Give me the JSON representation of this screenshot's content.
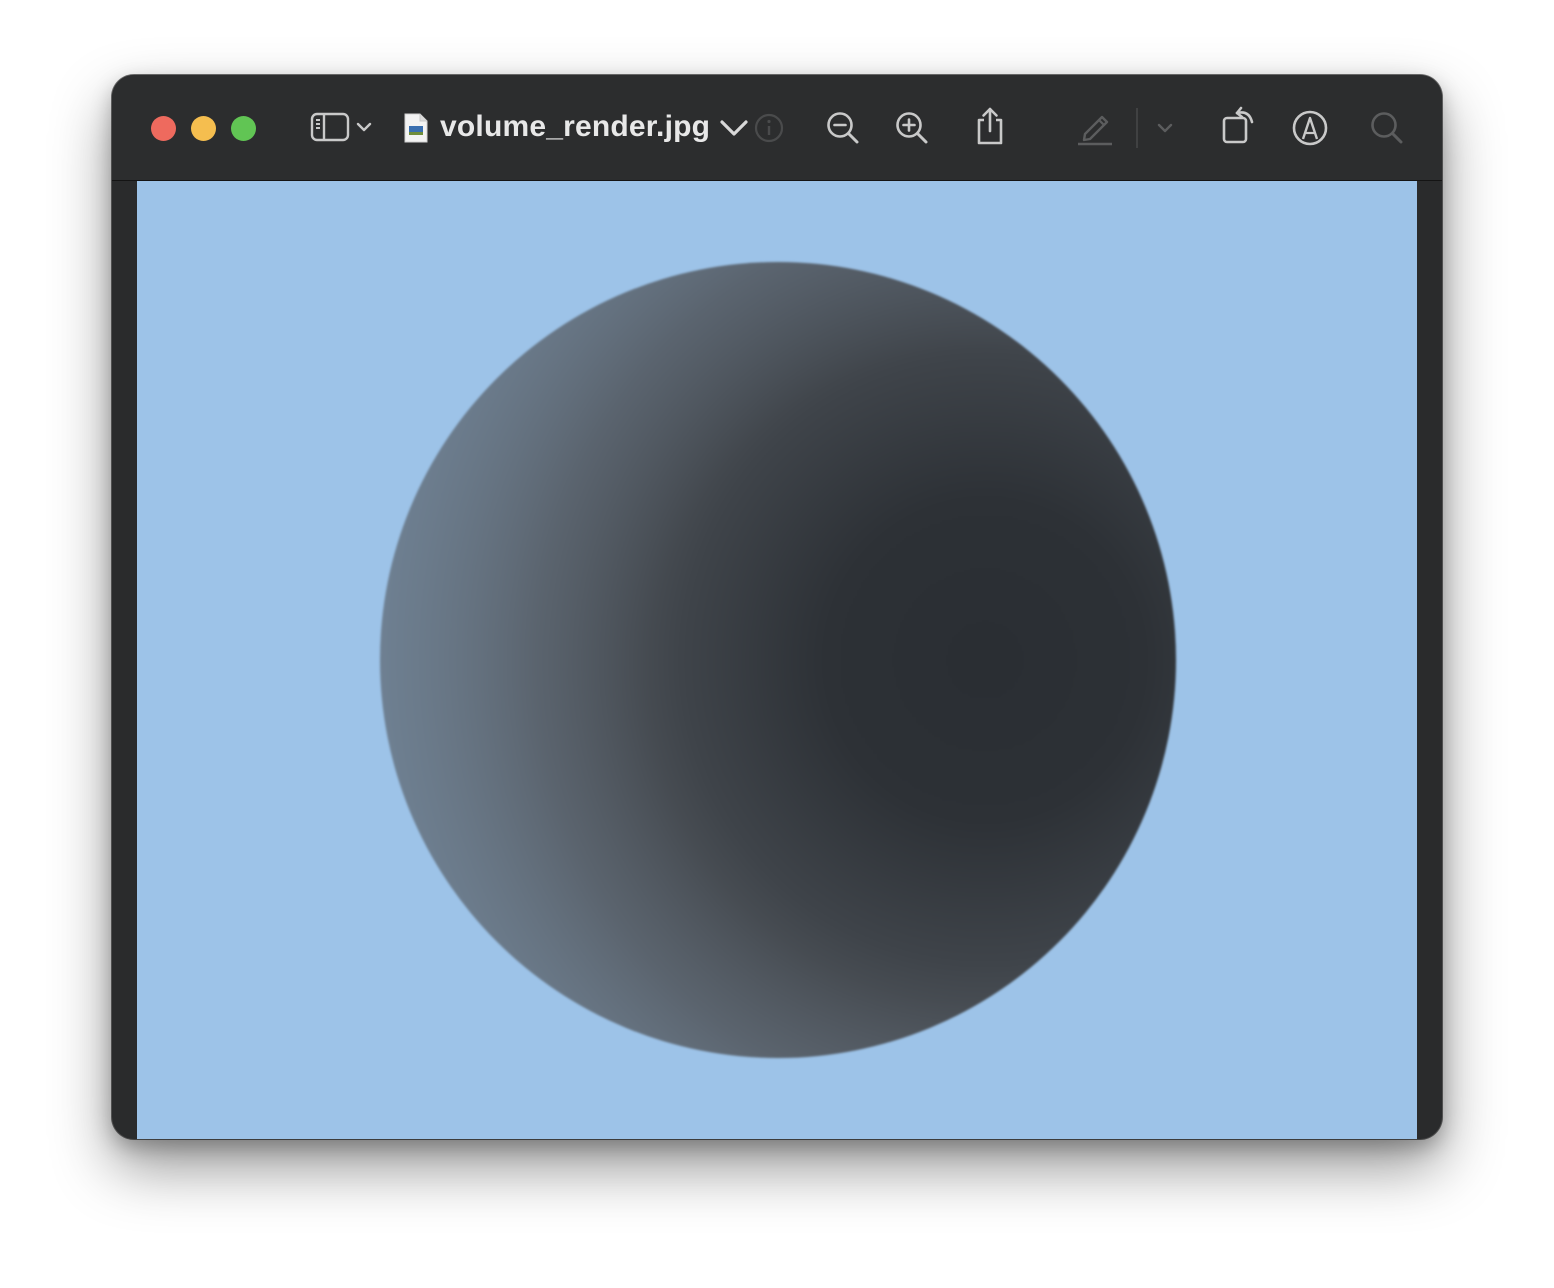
{
  "window": {
    "title": "volume_render.jpg",
    "accent": "#2c2d2e"
  },
  "toolbar": {
    "buttons": [
      {
        "name": "sidebar-toggle",
        "icon": "sidebar-icon"
      },
      {
        "name": "title-menu",
        "icon": "chevron-down-icon"
      },
      {
        "name": "info",
        "icon": "info-icon"
      },
      {
        "name": "zoom-out",
        "icon": "zoom-out-icon"
      },
      {
        "name": "zoom-in",
        "icon": "zoom-in-icon"
      },
      {
        "name": "share",
        "icon": "share-icon"
      },
      {
        "name": "markup-highlight",
        "icon": "pencil-icon"
      },
      {
        "name": "markup-menu",
        "icon": "chevron-down-icon"
      },
      {
        "name": "rotate",
        "icon": "rotate-icon"
      },
      {
        "name": "markup",
        "icon": "markup-icon"
      },
      {
        "name": "search",
        "icon": "search-icon"
      }
    ]
  },
  "image": {
    "background": "#9dc3e8",
    "subject": "shaded sphere"
  }
}
